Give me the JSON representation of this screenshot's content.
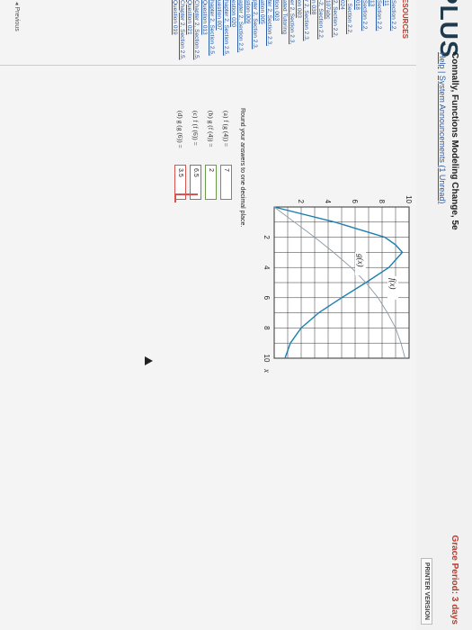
{
  "header": {
    "logo": "PLUS",
    "course": "Connally, Functions Modeling Change, 5e",
    "links": [
      "Help",
      "System Announcements (1 Unread)"
    ],
    "grace": "Grace Period: 3 days",
    "printer": "PRINTER VERSION"
  },
  "sidebar": {
    "title": "ESOURCES",
    "items": [
      "Section 2.2,",
      "11",
      "Section 2.2,",
      "13",
      "Section 2.2,",
      "018",
      ". Section 2.2,",
      "024",
      "2, Section 2.2,",
      "107abc",
      "-2, Section 2.2,",
      "n 038",
      "r 2, Section 2.3,",
      "on 003",
      "er 2, Section 2.3,",
      "ated Tutoring",
      "tion 003",
      "ter 2, Section 2.3,",
      "ation 005",
      "pter 2, Section 2.3,",
      "stion 009",
      "apter 2, Section 2.3,",
      "estion 020",
      "hapter 2, Section 2.5,",
      "uestion 007",
      "hapter 2, Section 2.5,",
      "Question 013",
      "Chapter 2, Section 2.5,",
      "Question 021",
      "Chapter 2, Section 2.5,",
      "Question 019"
    ],
    "previous": "◂ Previous"
  },
  "question": {
    "instruction": "Round your answers to one decimal place.",
    "parts": [
      {
        "label": "(a) f (g (4)) =",
        "value": "7",
        "status": "correct"
      },
      {
        "label": "(b) g (f (4)) =",
        "value": "2",
        "status": "correct"
      },
      {
        "label": "(c) f (f (6)) =",
        "value": "6.5",
        "status": "incorrect"
      },
      {
        "label": "(d) g (g (6)) =",
        "value": "3.5",
        "status": "incorrect"
      }
    ]
  },
  "chart_data": {
    "type": "line",
    "xlim": [
      0,
      10
    ],
    "ylim": [
      0,
      10
    ],
    "x_ticks": [
      2,
      4,
      6,
      8,
      10
    ],
    "y_ticks": [
      2,
      4,
      6,
      8,
      10
    ],
    "xlabel": "x",
    "grid": true,
    "series": [
      {
        "name": "f(x)",
        "x": [
          0,
          1,
          2,
          2.5,
          3,
          4,
          5,
          6,
          7,
          8,
          9,
          10
        ],
        "y": [
          0,
          4.5,
          8.2,
          9,
          9.5,
          8.5,
          6.8,
          5,
          3.3,
          2,
          1.2,
          0.8
        ]
      },
      {
        "name": "g(x)",
        "x": [
          0,
          1,
          2,
          3,
          4,
          5,
          6,
          7,
          8,
          9,
          10
        ],
        "y": [
          0,
          1.5,
          3,
          4.4,
          5.7,
          6.8,
          7.7,
          8.4,
          9,
          9.4,
          9.7
        ]
      }
    ]
  },
  "colors": {
    "f_curve": "#1a7fb0",
    "g_curve": "#8a9aa6",
    "grid": "#333333",
    "correct": "#6a9a4a",
    "incorrect": "#d9534f"
  }
}
